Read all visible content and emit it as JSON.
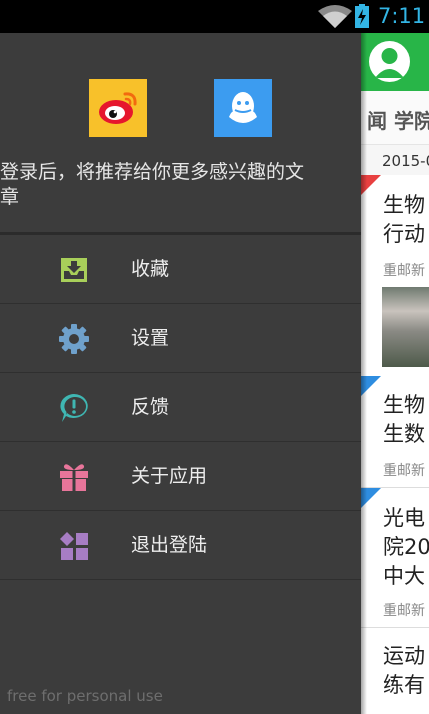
{
  "status_bar": {
    "time": "7:11",
    "wifi_icon": "wifi-icon",
    "battery_icon": "battery-charging-icon"
  },
  "background_content": {
    "tabs": "闻  学院",
    "date": "2015-0",
    "cards": [
      {
        "title": "生物\n行动",
        "meta": "重邮新",
        "badge_color": "#e84040"
      },
      {
        "title": "生物\n生数",
        "meta": "重邮新",
        "badge_color": "#2e8de0"
      },
      {
        "title": "光电\n院20\n中大",
        "meta": "重邮新",
        "badge_color": "#2e8de0"
      },
      {
        "title": "运动\n练有",
        "meta": "",
        "badge_color": ""
      }
    ],
    "colors": {
      "toolbar": "#28b548"
    }
  },
  "drawer": {
    "share": [
      {
        "name": "weibo",
        "icon": "weibo-icon",
        "color": "#f8c12a"
      },
      {
        "name": "qq",
        "icon": "qq-icon",
        "color": "#3c9cf0"
      }
    ],
    "login_hint": "登录后，将推荐给你更多感兴趣的文\n章",
    "menu": [
      {
        "label": "收藏",
        "icon": "favorites-inbox-icon",
        "color": "#a8cf5a"
      },
      {
        "label": "设置",
        "icon": "gear-icon",
        "color": "#6fa1cc"
      },
      {
        "label": "反馈",
        "icon": "feedback-bubble-icon",
        "color": "#3fb6b2"
      },
      {
        "label": "关于应用",
        "icon": "gift-icon",
        "color": "#e8759a"
      },
      {
        "label": "退出登陆",
        "icon": "logout-blocks-icon",
        "color": "#a77dc4"
      }
    ],
    "watermark": "free for personal use"
  }
}
